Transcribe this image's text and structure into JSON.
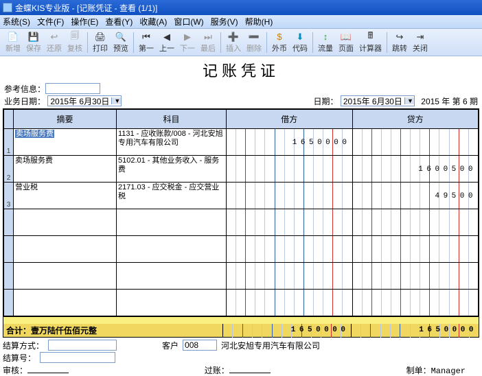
{
  "titlebar": "金蝶KIS专业版 - [记账凭证 - 查看 (1/1)]",
  "menu": {
    "sys": "系统(S)",
    "file": "文件(F)",
    "op": "操作(E)",
    "view": "查看(Y)",
    "fav": "收藏(A)",
    "win": "窗口(W)",
    "svc": "服务(V)",
    "help": "帮助(H)"
  },
  "toolbar": {
    "new": "新增",
    "save": "保存",
    "restore": "还原",
    "recover": "复核",
    "print": "打印",
    "preview": "预览",
    "first": "第一",
    "prev": "上一",
    "next": "下一",
    "last": "最后",
    "ins": "插入",
    "del": "删除",
    "fc": "外币",
    "code": "代码",
    "flow": "流量",
    "page": "页面",
    "calc": "计算器",
    "trans": "跳转",
    "close": "关闭"
  },
  "doc_title": "记账凭证",
  "ref_label": "参考信息：",
  "ref_value": "",
  "biz_date_label": "业务日期：",
  "biz_date": "2015年 6月30日",
  "date_label": "日期：",
  "date": "2015年 6月30日",
  "period": "2015 年 第 6 期",
  "columns": {
    "summary": "摘要",
    "account": "科目",
    "debit": "借方",
    "credit": "贷方"
  },
  "rows": [
    {
      "n": "1",
      "summary": "卖场服务费",
      "summary_selected": true,
      "account": "1131 - 应收账款/008 - 河北安旭专用汽车有限公司",
      "debit": "1650000",
      "credit": ""
    },
    {
      "n": "2",
      "summary": "卖场服务费",
      "account": "5102.01 - 其他业务收入 - 服务费",
      "debit": "",
      "credit": "1600500"
    },
    {
      "n": "3",
      "summary": "营业税",
      "account": "2171.03 - 应交税金 - 应交营业税",
      "debit": "",
      "credit": "49500"
    },
    {
      "n": "",
      "summary": "",
      "account": "",
      "debit": "",
      "credit": ""
    },
    {
      "n": "",
      "summary": "",
      "account": "",
      "debit": "",
      "credit": ""
    },
    {
      "n": "",
      "summary": "",
      "account": "",
      "debit": "",
      "credit": ""
    },
    {
      "n": "",
      "summary": "",
      "account": "",
      "debit": "",
      "credit": ""
    }
  ],
  "total": {
    "label": "合计：壹万陆仟伍佰元整",
    "debit": "1650000",
    "credit": "1650000"
  },
  "footer": {
    "settle_method_label": "结算方式：",
    "settle_method": "",
    "settle_no_label": "结算号：",
    "settle_no": "",
    "customer_label": "客户",
    "customer_code": "008",
    "customer_name": "河北安旭专用汽车有限公司",
    "audit_label": "审核：",
    "audit": "",
    "post_label": "过账：",
    "post": "",
    "maker_label": "制单：",
    "maker": "Manager"
  }
}
